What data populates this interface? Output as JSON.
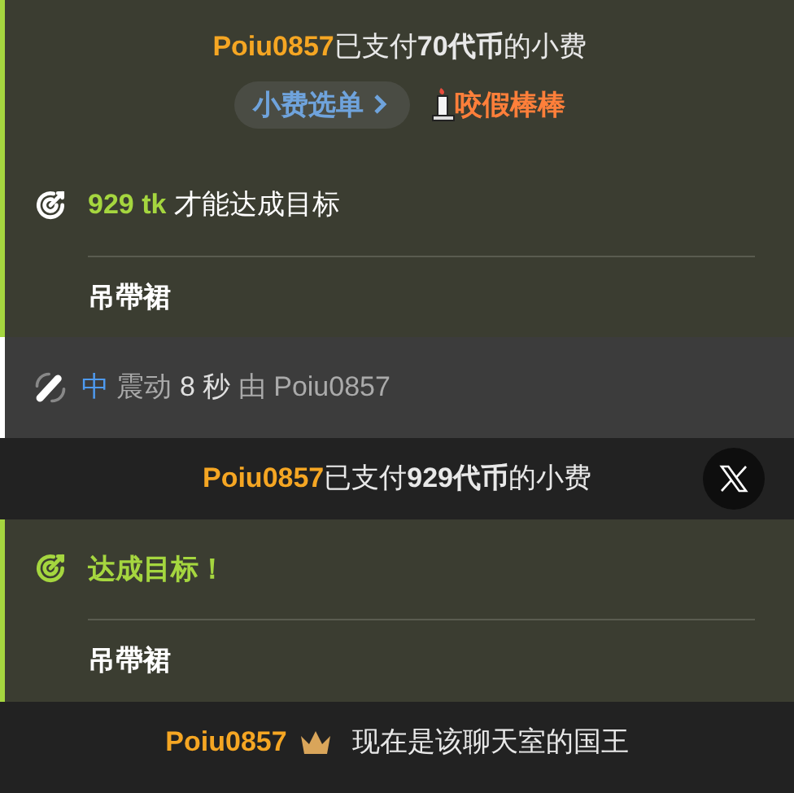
{
  "messages": [
    {
      "kind": "tip",
      "highlighted": true,
      "user": "Poiu0857",
      "text": "已支付**70代币**的小费",
      "menu_button": "小费选单",
      "item": "咬假棒棒"
    },
    {
      "kind": "goal",
      "reached": false,
      "amount": "929 tk",
      "text": "才能达成目标",
      "goal": "吊帶裙"
    },
    {
      "kind": "vibration",
      "strength": "中",
      "label": "震动",
      "duration": "8 秒",
      "by": "由 Poiu0857"
    },
    {
      "kind": "tip",
      "highlighted": false,
      "user": "Poiu0857",
      "text": "已支付**929代币**的小费",
      "share": true
    },
    {
      "kind": "goal",
      "reached": true,
      "title": "达成目标！",
      "goal": "吊帶裙"
    },
    {
      "kind": "king",
      "user": "Poiu0857",
      "text": "现在是该聊天室的国王"
    }
  ]
}
